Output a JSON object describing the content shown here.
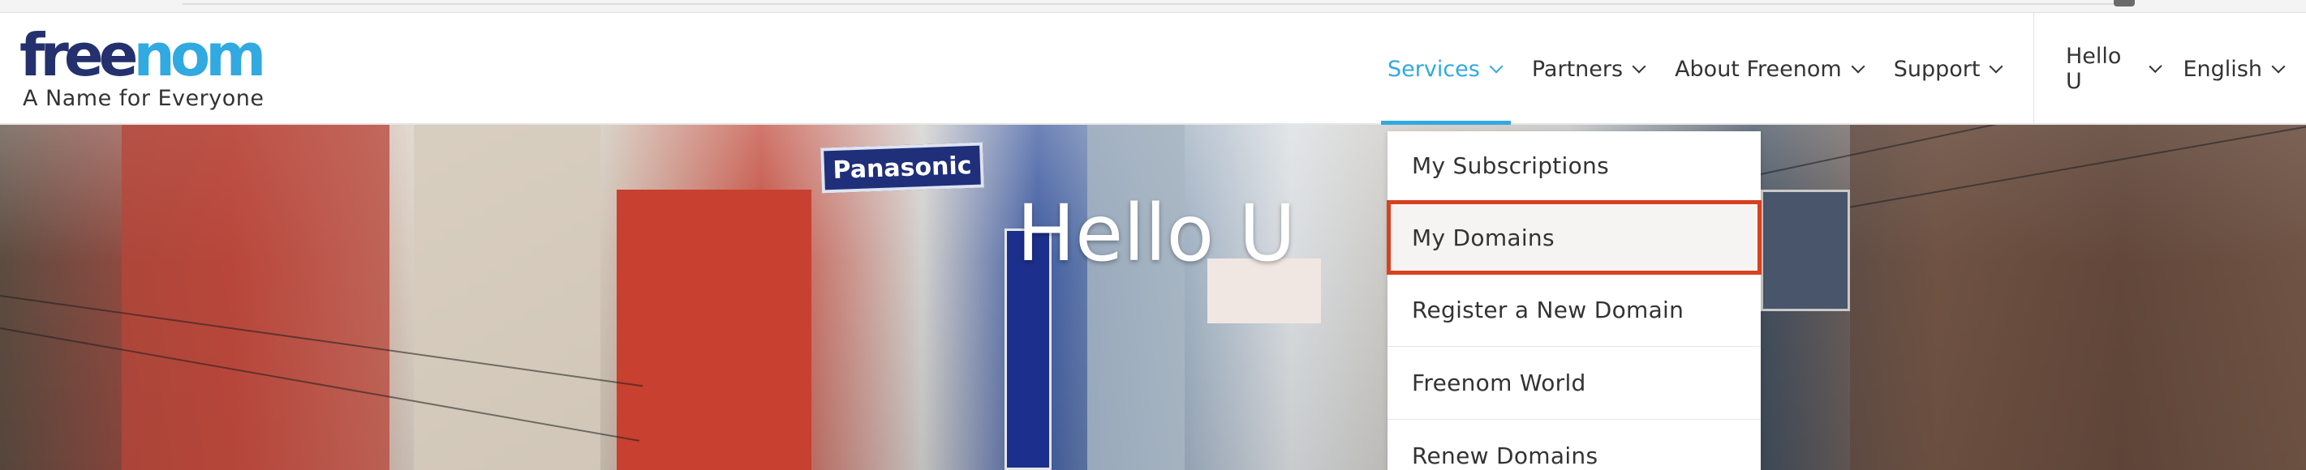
{
  "brand": {
    "logo_free": "free",
    "logo_nom": "nom",
    "tagline": "A Name for Everyone",
    "colors": {
      "dark_blue": "#25316e",
      "light_blue": "#31a9e1"
    }
  },
  "nav": {
    "items": [
      {
        "label": "Services",
        "active": true
      },
      {
        "label": "Partners",
        "active": false
      },
      {
        "label": "About Freenom",
        "active": false
      },
      {
        "label": "Support",
        "active": false
      }
    ],
    "user": {
      "label": "Hello U"
    },
    "language": {
      "label": "English"
    }
  },
  "hero": {
    "greeting": "Hello U",
    "signs": {
      "panasonic": "Panasonic"
    }
  },
  "services_menu": {
    "items": [
      {
        "label": "My Subscriptions"
      },
      {
        "label": "My Domains",
        "highlighted": true
      },
      {
        "label": "Register a New Domain"
      },
      {
        "label": "Freenom World"
      },
      {
        "label": "Renew Domains"
      }
    ],
    "highlight_color": "#d9401f"
  },
  "icons": {
    "chevron": "chevron-down-icon"
  }
}
